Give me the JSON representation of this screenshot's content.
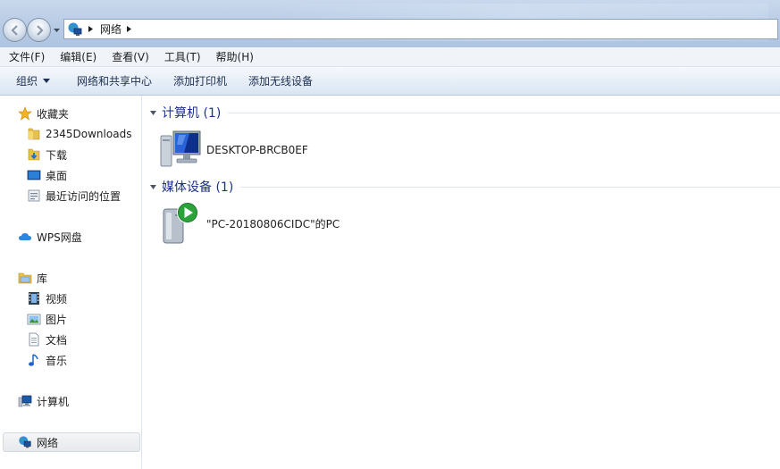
{
  "address": {
    "crumbs": [
      "网络"
    ]
  },
  "menu": {
    "items": [
      "文件(F)",
      "编辑(E)",
      "查看(V)",
      "工具(T)",
      "帮助(H)"
    ]
  },
  "toolbar": {
    "organize": "组织",
    "network_center": "网络和共享中心",
    "add_printer": "添加打印机",
    "add_wireless": "添加无线设备"
  },
  "sidebar": {
    "favorites": "收藏夹",
    "fav_items": [
      "2345Downloads",
      "下载",
      "桌面",
      "最近访问的位置"
    ],
    "wps": "WPS网盘",
    "library": "库",
    "lib_items": [
      "视频",
      "图片",
      "文档",
      "音乐"
    ],
    "computer": "计算机",
    "network": "网络"
  },
  "content": {
    "group1_title": "计算机 (1)",
    "group1_item": "DESKTOP-BRCB0EF",
    "group2_title": "媒体设备 (1)",
    "group2_item": "\"PC-20180806CIDC\"的PC"
  },
  "colors": {
    "accent": "#1e3287",
    "toolbar_bg": "#e7eef7",
    "titlebar_bg": "#b7cbe5"
  }
}
